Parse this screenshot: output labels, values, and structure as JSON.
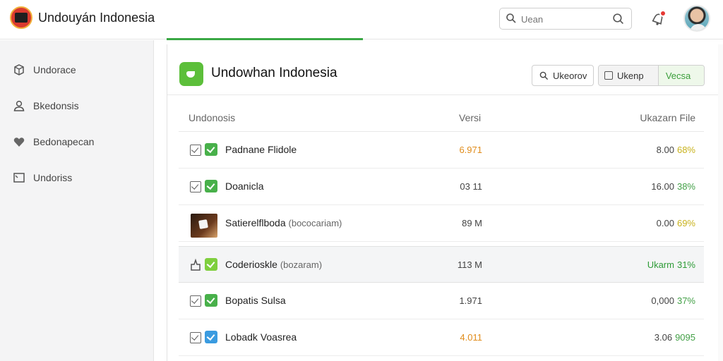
{
  "app": {
    "title": "Undouyán Indonesia"
  },
  "header": {
    "search_placeholder": "Uean",
    "notification_icon": "notification-bell-icon",
    "avatar_icon": "user-avatar"
  },
  "sidebar": {
    "items": [
      {
        "label": "Undorace",
        "icon": "box-icon"
      },
      {
        "label": "Bkedonsis",
        "icon": "user-icon"
      },
      {
        "label": "Bedonapecan",
        "icon": "heart-icon"
      },
      {
        "label": "Undoriss",
        "icon": "window-icon"
      }
    ]
  },
  "panel": {
    "title": "Undowhan Indonesia",
    "search_button": "Ukeorov",
    "toggle": {
      "left": "Ukenp",
      "right": "Vecsa"
    }
  },
  "table": {
    "columns": [
      "Undonosis",
      "Versi",
      "Ukazarn File"
    ],
    "rows": [
      {
        "name": "Padnane Flidole",
        "sub": "",
        "version": "6.971",
        "version_color": "#e08c1b",
        "size": "8.00",
        "pct": "68%",
        "pct_color": "#c8b21d",
        "selected": false,
        "lead": "check",
        "badge_color": "#48b04a"
      },
      {
        "name": "Doanicla",
        "sub": "",
        "version": "03 11",
        "version_color": "#444444",
        "size": "16.00",
        "pct": "38%",
        "pct_color": "#43a047",
        "selected": false,
        "lead": "check",
        "badge_color": "#48b04a"
      },
      {
        "name": "Satierelflboda",
        "sub": "(bococariam)",
        "version": "89 M",
        "version_color": "#444444",
        "size": "0.00",
        "pct": "69%",
        "pct_color": "#c8b21d",
        "selected": false,
        "lead": "thumb",
        "badge_color": ""
      },
      {
        "name": "Coderioskle",
        "sub": "(bozaram)",
        "version": "113 M",
        "version_color": "#444444",
        "size": "Ukarm",
        "pct": "31%",
        "pct_color": "#2e9b37",
        "selected": true,
        "lead": "star",
        "badge_color": "#7fcf3e"
      },
      {
        "name": "Bopatis Sulsa",
        "sub": "",
        "version": "1.971",
        "version_color": "#444444",
        "size": "0,000",
        "pct": "37%",
        "pct_color": "#43a047",
        "selected": false,
        "lead": "check",
        "badge_color": "#48b04a"
      },
      {
        "name": "Lobadk Voasrea",
        "sub": "",
        "version": "4.011",
        "version_color": "#e08c1b",
        "size": "3.06",
        "pct": "9095",
        "pct_color": "#43a047",
        "selected": false,
        "lead": "check",
        "badge_color": "#3a9be0"
      }
    ]
  }
}
